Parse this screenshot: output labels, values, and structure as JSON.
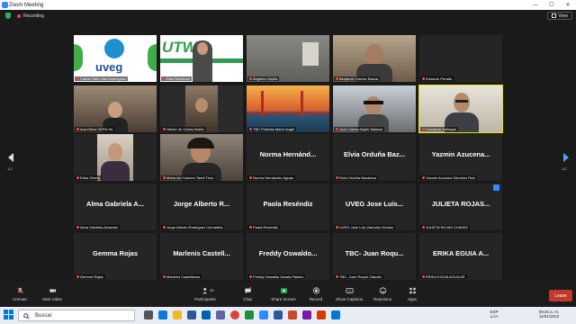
{
  "window": {
    "title": "Zoom Meeting",
    "controls": [
      "—",
      "☐",
      "✕"
    ]
  },
  "meeting": {
    "recording_label": "Recording",
    "view_label": "View"
  },
  "pagination": {
    "left": "1/2",
    "right": "1/2"
  },
  "tiles": [
    {
      "label": "Carlos Ortiz Villa Dominguez",
      "kind": "logo-uveg",
      "muted": true
    },
    {
      "label": "Raúl Mendoza",
      "kind": "logo-utm",
      "muted": true
    },
    {
      "label": "Ángeles Ospña",
      "kind": "video-room",
      "muted": true
    },
    {
      "label": "Benjamin Gómez Baeza",
      "kind": "video-man",
      "muted": true
    },
    {
      "label": "Eduardo Peralta",
      "kind": "blank",
      "muted": true
    },
    {
      "label": "Ana Elena VERA Sa",
      "kind": "video-woman",
      "muted": true
    },
    {
      "label": "Héctor de Carlos Burke",
      "kind": "video-man2",
      "muted": true
    },
    {
      "label": "TBC Felicitas Marín Angel",
      "kind": "video-bridge",
      "muted": true
    },
    {
      "label": "Juan Carlos Esplin Salazar",
      "kind": "video-car",
      "muted": true
    },
    {
      "label": "Leonardo Gallegos",
      "kind": "video-man3",
      "muted": true,
      "speaking": true
    },
    {
      "label": "Erika Olvera",
      "kind": "video-woman2",
      "muted": true
    },
    {
      "label": "Maria del Carmen Tarell Tirzo",
      "kind": "video-woman3",
      "muted": true
    },
    {
      "label": "Norma Hernández Aguas",
      "big": "Norma Hernánd...",
      "kind": "name",
      "muted": true
    },
    {
      "label": "Elvia Orduña Bazaldua",
      "big": "Elvia Orduña Baz...",
      "kind": "name",
      "muted": true
    },
    {
      "label": "Yazmin Azucena Sánchez Ruiz",
      "big": "Yazmin Azucena...",
      "kind": "name",
      "muted": true
    },
    {
      "label": "Alma Gabriela Alvarado",
      "big": "Alma Gabriela A...",
      "kind": "name",
      "muted": true
    },
    {
      "label": "Jorge Alberto Rodríguez Cervantes",
      "big": "Jorge Alberto R...",
      "kind": "name",
      "muted": true
    },
    {
      "label": "Paola Reséndiz",
      "big": "Paola Reséndiz",
      "kind": "name",
      "muted": true
    },
    {
      "label": "UVEG José Luis Zamudio Gómez",
      "big": "UVEG Jose Luis...",
      "kind": "name",
      "muted": true
    },
    {
      "label": "JULIETA ROJAS CHAVEZ",
      "big": "JULIETA ROJAS...",
      "kind": "name",
      "muted": true
    },
    {
      "label": "Gemma Rojas",
      "big": "Gemma Rojas",
      "kind": "name",
      "muted": true
    },
    {
      "label": "Marlenis Castellanos",
      "big": "Marlenis Castell...",
      "kind": "name",
      "muted": true
    },
    {
      "label": "Freddy Oswaldo Zavala Palacio",
      "big": "Freddy Oswaldo...",
      "kind": "name",
      "muted": true
    },
    {
      "label": "TBC- Juan Roque Claudio",
      "big": "TBC- Juan Roqu...",
      "kind": "name",
      "muted": true
    },
    {
      "label": "ERIKA EGUIA AGUILAR",
      "big": "ERIKA EGUIA A...",
      "kind": "name",
      "muted": true
    }
  ],
  "toolbar": {
    "unmute": "Unmute",
    "start_video": "Start Video",
    "participants": "Participants",
    "participants_count": "45",
    "chat": "Chat",
    "share_screen": "Share Screen",
    "record": "Record",
    "show_captions": "Show Captions",
    "reactions": "Reactions",
    "apps": "Apps",
    "leave": "Leave"
  },
  "taskbar": {
    "search": "Buscar",
    "lang_top": "ESP",
    "lang_bottom": "LAA",
    "time": "09:45 a. m.",
    "date": "11/01/2023"
  },
  "colors": {
    "accent": "#2d8cff",
    "leave": "#c0392b",
    "share": "#22b14c",
    "speaking": "#e6e600"
  }
}
